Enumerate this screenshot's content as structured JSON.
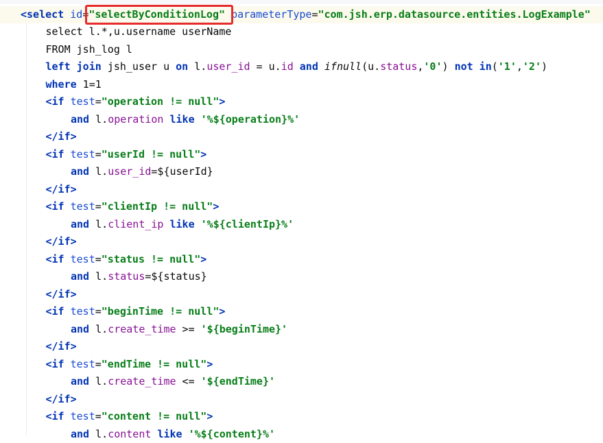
{
  "editor": {
    "lines": [
      {
        "indent": 0,
        "tokens": [
          {
            "c": "t-tag",
            "t": "<select "
          },
          {
            "c": "t-attr",
            "t": "id"
          },
          {
            "c": "t-plain",
            "t": "="
          },
          {
            "c": "t-str",
            "t": "\"selectByConditionLog\""
          },
          {
            "c": "t-plain",
            "t": " "
          },
          {
            "c": "t-attr",
            "t": "parameterType"
          },
          {
            "c": "t-plain",
            "t": "="
          },
          {
            "c": "t-str",
            "t": "\"com.jsh.erp.datasource.entities.LogExample\""
          }
        ]
      },
      {
        "indent": 1,
        "tokens": [
          {
            "c": "t-plain",
            "t": "select l.*,u.username userName"
          }
        ]
      },
      {
        "indent": 1,
        "tokens": [
          {
            "c": "t-plain",
            "t": "FROM jsh_log l"
          }
        ]
      },
      {
        "indent": 1,
        "tokens": [
          {
            "c": "t-kw",
            "t": "left join"
          },
          {
            "c": "t-plain",
            "t": " jsh_user u "
          },
          {
            "c": "t-kw",
            "t": "on"
          },
          {
            "c": "t-plain",
            "t": " l."
          },
          {
            "c": "t-id",
            "t": "user_id"
          },
          {
            "c": "t-plain",
            "t": " = u."
          },
          {
            "c": "t-id",
            "t": "id"
          },
          {
            "c": "t-plain",
            "t": " "
          },
          {
            "c": "t-kw",
            "t": "and"
          },
          {
            "c": "t-plain",
            "t": " "
          },
          {
            "c": "t-fn",
            "t": "ifnull"
          },
          {
            "c": "t-plain",
            "t": "(u."
          },
          {
            "c": "t-id",
            "t": "status"
          },
          {
            "c": "t-plain",
            "t": ","
          },
          {
            "c": "t-str",
            "t": "'0'"
          },
          {
            "c": "t-plain",
            "t": ") "
          },
          {
            "c": "t-kw",
            "t": "not in"
          },
          {
            "c": "t-plain",
            "t": "("
          },
          {
            "c": "t-str",
            "t": "'1'"
          },
          {
            "c": "t-plain",
            "t": ","
          },
          {
            "c": "t-str",
            "t": "'2'"
          },
          {
            "c": "t-plain",
            "t": ")"
          }
        ]
      },
      {
        "indent": 1,
        "tokens": [
          {
            "c": "t-kw",
            "t": "where"
          },
          {
            "c": "t-plain",
            "t": " 1=1"
          }
        ]
      },
      {
        "indent": 1,
        "tokens": [
          {
            "c": "t-tag",
            "t": "<if "
          },
          {
            "c": "t-attr",
            "t": "test"
          },
          {
            "c": "t-plain",
            "t": "="
          },
          {
            "c": "t-str",
            "t": "\"operation != null\""
          },
          {
            "c": "t-tag",
            "t": ">"
          }
        ]
      },
      {
        "indent": 2,
        "tokens": [
          {
            "c": "t-kw",
            "t": "and"
          },
          {
            "c": "t-plain",
            "t": " l."
          },
          {
            "c": "t-id",
            "t": "operation"
          },
          {
            "c": "t-plain",
            "t": " "
          },
          {
            "c": "t-kw",
            "t": "like"
          },
          {
            "c": "t-plain",
            "t": " "
          },
          {
            "c": "t-str",
            "t": "'%${operation}%'"
          }
        ]
      },
      {
        "indent": 1,
        "tokens": [
          {
            "c": "t-tag",
            "t": "</if>"
          }
        ]
      },
      {
        "indent": 1,
        "tokens": [
          {
            "c": "t-tag",
            "t": "<if "
          },
          {
            "c": "t-attr",
            "t": "test"
          },
          {
            "c": "t-plain",
            "t": "="
          },
          {
            "c": "t-str",
            "t": "\"userId != null\""
          },
          {
            "c": "t-tag",
            "t": ">"
          }
        ]
      },
      {
        "indent": 2,
        "tokens": [
          {
            "c": "t-kw",
            "t": "and"
          },
          {
            "c": "t-plain",
            "t": " l."
          },
          {
            "c": "t-id",
            "t": "user_id"
          },
          {
            "c": "t-plain",
            "t": "=${userId}"
          }
        ]
      },
      {
        "indent": 1,
        "tokens": [
          {
            "c": "t-tag",
            "t": "</if>"
          }
        ]
      },
      {
        "indent": 1,
        "tokens": [
          {
            "c": "t-tag",
            "t": "<if "
          },
          {
            "c": "t-attr",
            "t": "test"
          },
          {
            "c": "t-plain",
            "t": "="
          },
          {
            "c": "t-str",
            "t": "\"clientIp != null\""
          },
          {
            "c": "t-tag",
            "t": ">"
          }
        ]
      },
      {
        "indent": 2,
        "tokens": [
          {
            "c": "t-kw",
            "t": "and"
          },
          {
            "c": "t-plain",
            "t": " l."
          },
          {
            "c": "t-id",
            "t": "client_ip"
          },
          {
            "c": "t-plain",
            "t": " "
          },
          {
            "c": "t-kw",
            "t": "like"
          },
          {
            "c": "t-plain",
            "t": " "
          },
          {
            "c": "t-str",
            "t": "'%${clientIp}%'"
          }
        ]
      },
      {
        "indent": 1,
        "tokens": [
          {
            "c": "t-tag",
            "t": "</if>"
          }
        ]
      },
      {
        "indent": 1,
        "tokens": [
          {
            "c": "t-tag",
            "t": "<if "
          },
          {
            "c": "t-attr",
            "t": "test"
          },
          {
            "c": "t-plain",
            "t": "="
          },
          {
            "c": "t-str",
            "t": "\"status != null\""
          },
          {
            "c": "t-tag",
            "t": ">"
          }
        ]
      },
      {
        "indent": 2,
        "tokens": [
          {
            "c": "t-kw",
            "t": "and"
          },
          {
            "c": "t-plain",
            "t": " l."
          },
          {
            "c": "t-id",
            "t": "status"
          },
          {
            "c": "t-plain",
            "t": "=${status}"
          }
        ]
      },
      {
        "indent": 1,
        "tokens": [
          {
            "c": "t-tag",
            "t": "</if>"
          }
        ]
      },
      {
        "indent": 1,
        "tokens": [
          {
            "c": "t-tag",
            "t": "<if "
          },
          {
            "c": "t-attr",
            "t": "test"
          },
          {
            "c": "t-plain",
            "t": "="
          },
          {
            "c": "t-str",
            "t": "\"beginTime != null\""
          },
          {
            "c": "t-tag",
            "t": ">"
          }
        ]
      },
      {
        "indent": 2,
        "tokens": [
          {
            "c": "t-kw",
            "t": "and"
          },
          {
            "c": "t-plain",
            "t": " l."
          },
          {
            "c": "t-id",
            "t": "create_time"
          },
          {
            "c": "t-plain",
            "t": " >= "
          },
          {
            "c": "t-str",
            "t": "'${beginTime}'"
          }
        ]
      },
      {
        "indent": 1,
        "tokens": [
          {
            "c": "t-tag",
            "t": "</if>"
          }
        ]
      },
      {
        "indent": 1,
        "tokens": [
          {
            "c": "t-tag",
            "t": "<if "
          },
          {
            "c": "t-attr",
            "t": "test"
          },
          {
            "c": "t-plain",
            "t": "="
          },
          {
            "c": "t-str",
            "t": "\"endTime != null\""
          },
          {
            "c": "t-tag",
            "t": ">"
          }
        ]
      },
      {
        "indent": 2,
        "tokens": [
          {
            "c": "t-kw",
            "t": "and"
          },
          {
            "c": "t-plain",
            "t": " l."
          },
          {
            "c": "t-id",
            "t": "create_time"
          },
          {
            "c": "t-plain",
            "t": " <= "
          },
          {
            "c": "t-str",
            "t": "'${endTime}'"
          }
        ]
      },
      {
        "indent": 1,
        "tokens": [
          {
            "c": "t-tag",
            "t": "</if>"
          }
        ]
      },
      {
        "indent": 1,
        "tokens": [
          {
            "c": "t-tag",
            "t": "<if "
          },
          {
            "c": "t-attr",
            "t": "test"
          },
          {
            "c": "t-plain",
            "t": "="
          },
          {
            "c": "t-str",
            "t": "\"content != null\""
          },
          {
            "c": "t-tag",
            "t": ">"
          }
        ]
      },
      {
        "indent": 2,
        "tokens": [
          {
            "c": "t-kw",
            "t": "and"
          },
          {
            "c": "t-plain",
            "t": " l."
          },
          {
            "c": "t-id",
            "t": "content"
          },
          {
            "c": "t-plain",
            "t": " "
          },
          {
            "c": "t-kw",
            "t": "like"
          },
          {
            "c": "t-plain",
            "t": " "
          },
          {
            "c": "t-str",
            "t": "'%${content}%'"
          }
        ]
      }
    ],
    "highlight_color": "#e52b2b"
  }
}
